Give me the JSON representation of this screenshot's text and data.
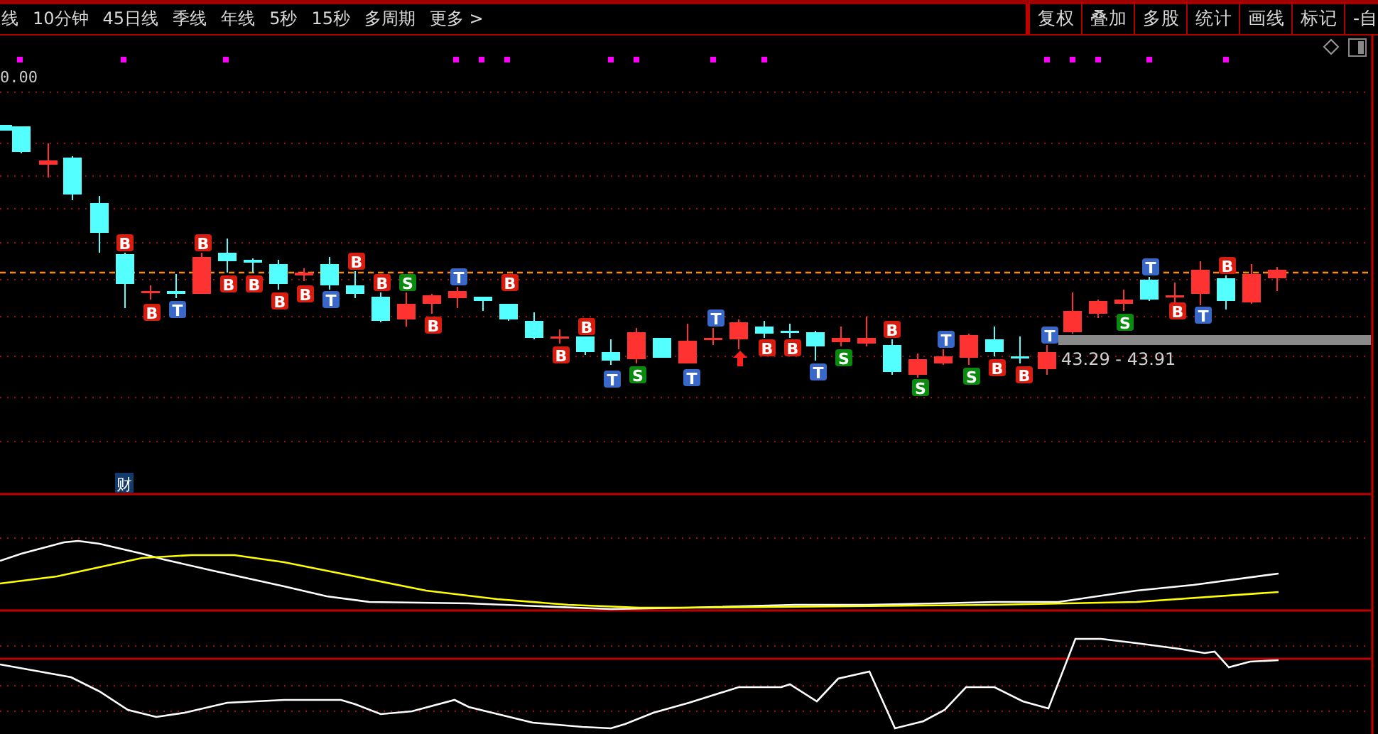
{
  "toolbar": {
    "periods": [
      "线",
      "10分钟",
      "45日线",
      "季线",
      "年线",
      "5秒",
      "15秒",
      "多周期",
      "更多 >"
    ],
    "tools": [
      "复权",
      "叠加",
      "多股",
      "统计",
      "画线",
      "标记",
      "-自"
    ]
  },
  "price_label": "0.00",
  "range_label": "43.29 - 43.91",
  "finance_badge": "财",
  "signals": [
    {
      "kind": "buy",
      "label": "B"
    },
    {
      "kind": "buy",
      "label": "B"
    },
    {
      "kind": "t",
      "label": "T"
    },
    {
      "kind": "buy",
      "label": "B"
    },
    {
      "kind": "buy",
      "label": "B"
    },
    {
      "kind": "buy",
      "label": "B"
    },
    {
      "kind": "buy",
      "label": "B"
    },
    {
      "kind": "buy",
      "label": "B"
    },
    {
      "kind": "t",
      "label": "T"
    },
    {
      "kind": "buy",
      "label": "B"
    },
    {
      "kind": "buy",
      "label": "B"
    },
    {
      "kind": "sell",
      "label": "S"
    },
    {
      "kind": "buy",
      "label": "B"
    },
    {
      "kind": "t",
      "label": "T"
    },
    {
      "kind": "buy",
      "label": "B"
    },
    {
      "kind": "buy",
      "label": "B"
    },
    {
      "kind": "buy",
      "label": "B"
    },
    {
      "kind": "t",
      "label": "T"
    },
    {
      "kind": "sell",
      "label": "S"
    },
    {
      "kind": "t",
      "label": "T"
    },
    {
      "kind": "t",
      "label": "T"
    },
    {
      "kind": "buy",
      "label": "B"
    },
    {
      "kind": "buy",
      "label": "B"
    },
    {
      "kind": "t",
      "label": "T"
    },
    {
      "kind": "sell",
      "label": "S"
    },
    {
      "kind": "buy",
      "label": "B"
    },
    {
      "kind": "sell",
      "label": "S"
    },
    {
      "kind": "t",
      "label": "T"
    },
    {
      "kind": "sell",
      "label": "S"
    },
    {
      "kind": "buy",
      "label": "B"
    },
    {
      "kind": "buy",
      "label": "B"
    },
    {
      "kind": "t",
      "label": "T"
    },
    {
      "kind": "sell",
      "label": "S"
    },
    {
      "kind": "t",
      "label": "T"
    },
    {
      "kind": "buy",
      "label": "B"
    },
    {
      "kind": "t",
      "label": "T"
    },
    {
      "kind": "buy",
      "label": "B"
    }
  ]
}
